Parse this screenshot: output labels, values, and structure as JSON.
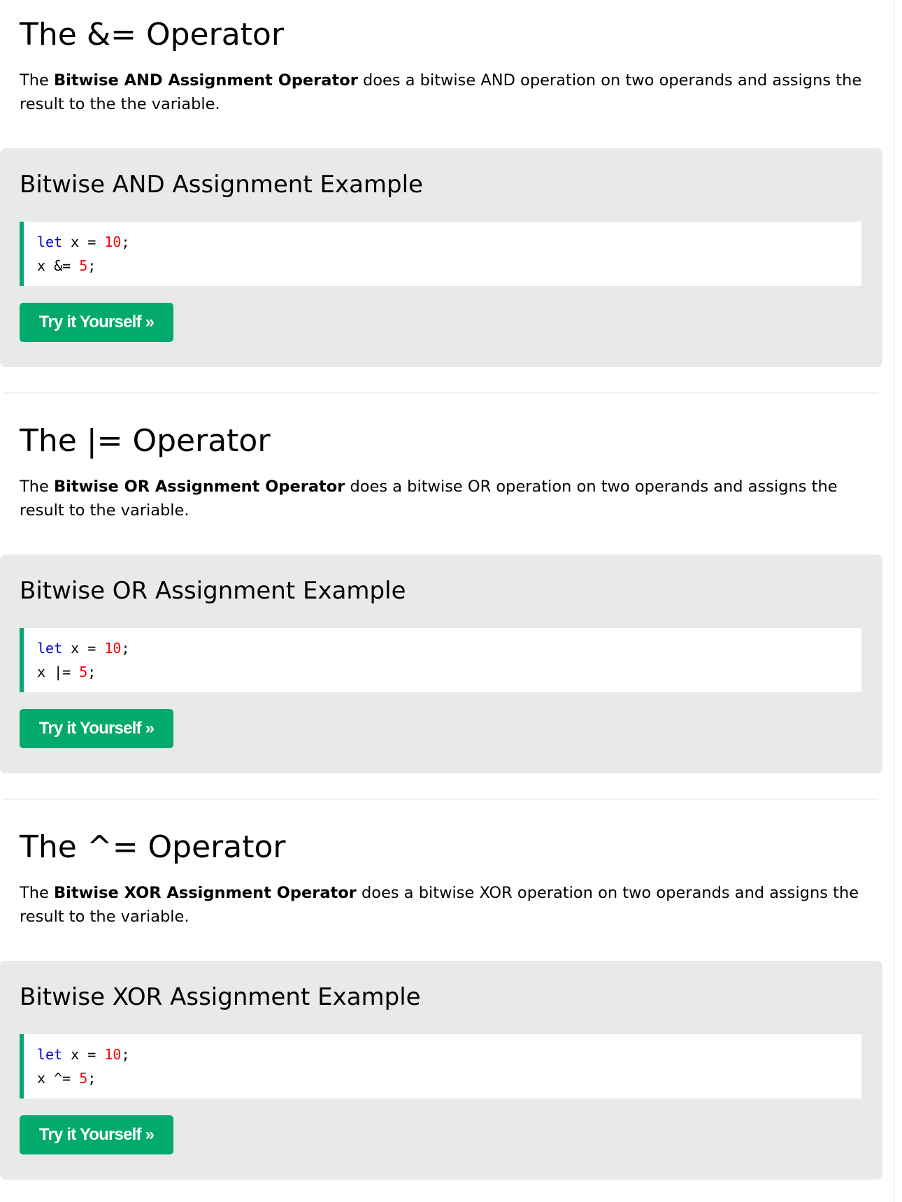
{
  "sections": [
    {
      "title": "The &= Operator",
      "intro_before": "The ",
      "intro_bold": "Bitwise AND Assignment Operator",
      "intro_after": " does a bitwise AND operation on two operands and assigns the result to the the variable.",
      "example_title": "Bitwise AND Assignment Example",
      "code": {
        "line1": {
          "kw": "let",
          "mid": " x = ",
          "num": "10",
          "end": ";"
        },
        "line2": {
          "pre": "x &= ",
          "num": "5",
          "end": ";"
        }
      },
      "button_label": "Try it Yourself »"
    },
    {
      "title": "The |= Operator",
      "intro_before": "The ",
      "intro_bold": "Bitwise OR Assignment Operator",
      "intro_after": " does a bitwise OR operation on two operands and assigns the result to the variable.",
      "example_title": "Bitwise OR Assignment Example",
      "code": {
        "line1": {
          "kw": "let",
          "mid": " x = ",
          "num": "10",
          "end": ";"
        },
        "line2": {
          "pre": "x |= ",
          "num": "5",
          "end": ";"
        }
      },
      "button_label": "Try it Yourself »"
    },
    {
      "title": "The ^= Operator",
      "intro_before": "The ",
      "intro_bold": "Bitwise XOR Assignment Operator",
      "intro_after": " does a bitwise XOR operation on two operands and assigns the result to the variable.",
      "example_title": "Bitwise XOR Assignment Example",
      "code": {
        "line1": {
          "kw": "let",
          "mid": " x = ",
          "num": "10",
          "end": ";"
        },
        "line2": {
          "pre": "x ^= ",
          "num": "5",
          "end": ";"
        }
      },
      "button_label": "Try it Yourself »"
    }
  ],
  "colors": {
    "button": "#04aa6d",
    "example_bg": "#e7e9eb",
    "code_keyword": "#0000cd",
    "code_number": "#ff0000"
  }
}
